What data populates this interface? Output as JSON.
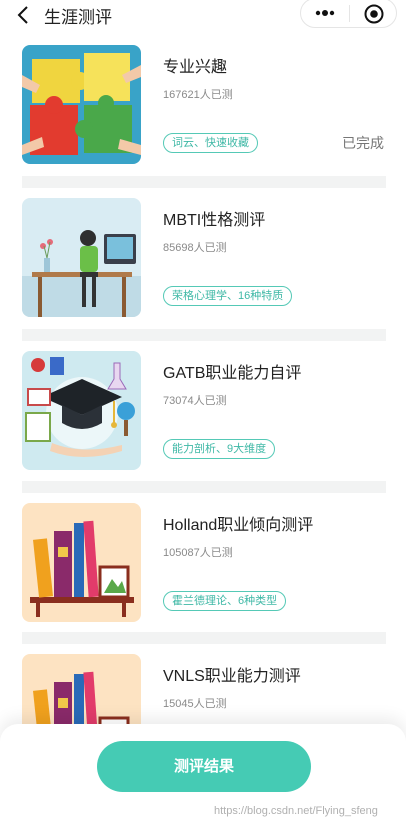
{
  "nav": {
    "title": "生涯测评"
  },
  "items": [
    {
      "title": "专业兴趣",
      "count": "167621人已测",
      "tag": "词云、快速收藏",
      "status": "已完成"
    },
    {
      "title": "MBTI性格测评",
      "count": "85698人已测",
      "tag": "荣格心理学、16种特质"
    },
    {
      "title": "GATB职业能力自评",
      "count": "73074人已测",
      "tag": "能力剖析、9大维度"
    },
    {
      "title": "Holland职业倾向测评",
      "count": "105087人已测",
      "tag": "霍兰德理论、6种类型"
    },
    {
      "title": "VNLS职业能力测评",
      "count": "15045人已测"
    }
  ],
  "bottom": {
    "button_label": "测评结果",
    "watermark": "https://blog.csdn.net/Flying_sfeng"
  },
  "colors": {
    "accent": "#45cbb4",
    "tag_border": "#55c9b6",
    "separator": "#f2f3f3"
  }
}
